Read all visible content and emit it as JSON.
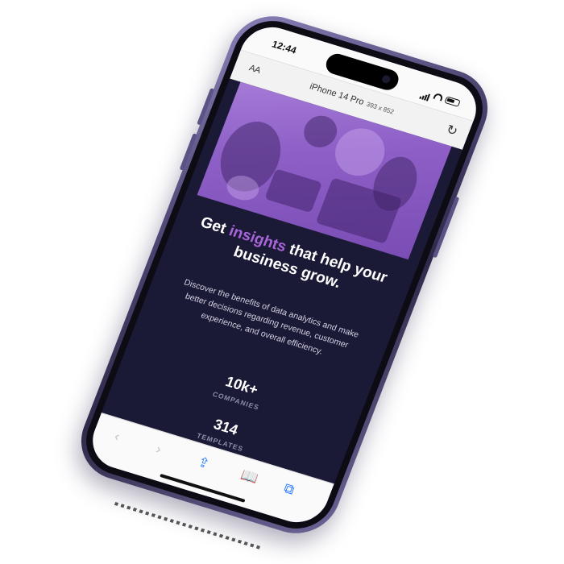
{
  "status_bar": {
    "time": "12:44"
  },
  "browser": {
    "text_size_label": "AA",
    "page_title": "iPhone 14 Pro",
    "viewport_dims": "393 x 852"
  },
  "hero": {
    "headline_before": "Get ",
    "headline_accent": "insights",
    "headline_after": " that help your business grow.",
    "description": "Discover the benefits of data analytics and make better decisions regarding revenue, customer experience, and overall efficiency."
  },
  "stats": [
    {
      "value": "10k+",
      "label": "COMPANIES"
    },
    {
      "value": "314",
      "label": "TEMPLATES"
    }
  ],
  "toolbar": {
    "back_icon": "chevron-left-icon",
    "forward_icon": "chevron-right-icon",
    "share_icon": "share-icon",
    "bookmarks_icon": "book-icon",
    "tabs_icon": "tabs-icon"
  },
  "colors": {
    "page_bg": "#1b1a36",
    "accent": "#a765d8",
    "hero_overlay": "#8d5fc7",
    "frame": "#4a4370",
    "link_blue": "#2a7bff"
  }
}
